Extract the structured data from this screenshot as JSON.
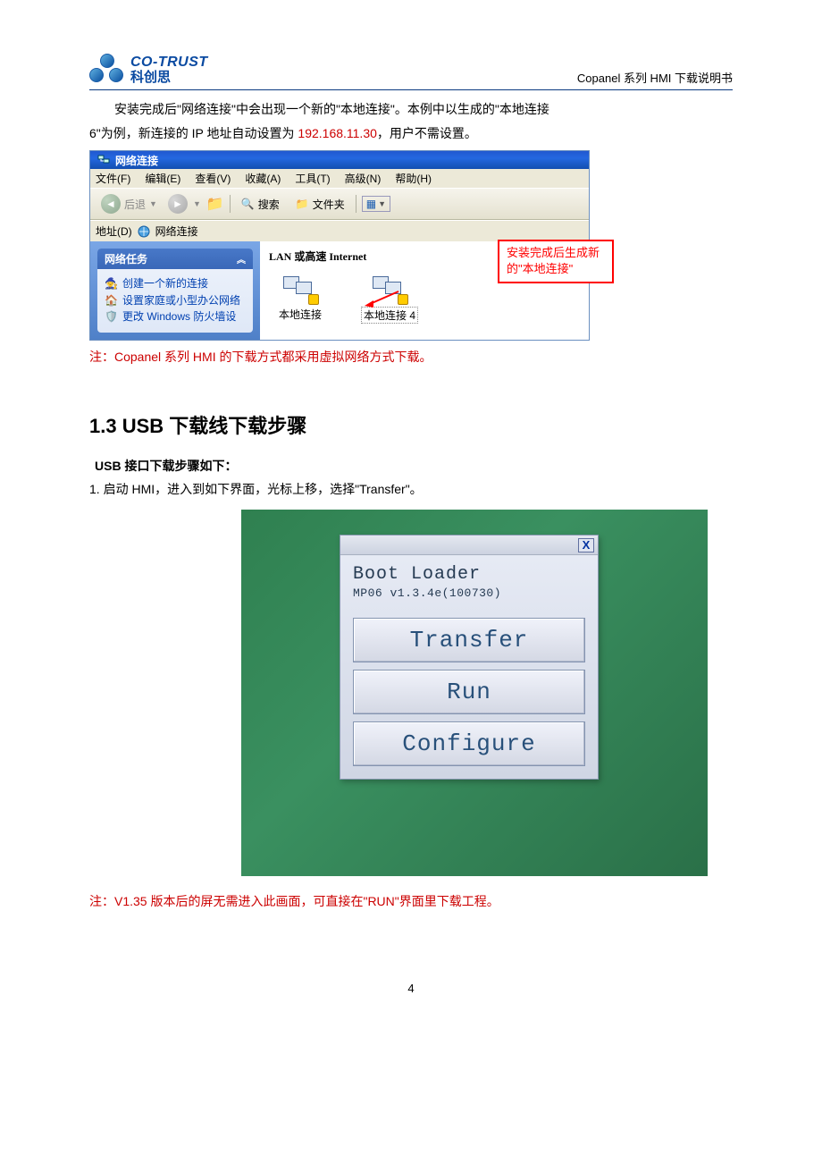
{
  "header": {
    "logo_en": "CO-TRUST",
    "logo_cn": "科创思",
    "doc_title": "Copanel 系列 HMI 下载说明书"
  },
  "intro": {
    "line1_a": "安装完成后\"网络连接\"中会出现一个新的\"本地连接\"。本例中以生成的\"本地连接",
    "line2_a": "6\"为例，新连接的 IP 地址自动设置为 ",
    "ip": "192.168.11.30",
    "line2_b": "，用户不需设置。"
  },
  "xp": {
    "title": "网络连接",
    "menu": {
      "file": "文件(F)",
      "edit": "编辑(E)",
      "view": "查看(V)",
      "fav": "收藏(A)",
      "tools": "工具(T)",
      "adv": "高级(N)",
      "help": "帮助(H)"
    },
    "toolbar": {
      "back": "后退",
      "search": "搜索",
      "folders": "文件夹"
    },
    "addr_label": "地址(D)",
    "addr_value": "网络连接",
    "side_title": "网络任务",
    "tasks": {
      "t1": "创建一个新的连接",
      "t2": "设置家庭或小型办公网络",
      "t3": "更改 Windows 防火墙设"
    },
    "section": "LAN 或高速 Internet",
    "conn1": "本地连接",
    "conn2": "本地连接 ⁠4",
    "callout": "安装完成后生成新的\"本地连接\""
  },
  "note1": "注：Copanel 系列 HMI 的下载方式都采用虚拟网络方式下载。",
  "section13": {
    "title": "1.3 USB 下载线下载步骤",
    "bold": "USB 接口下载步骤如下：",
    "step1": "1. 启动 HMI，进入到如下界面，光标上移，选择\"Transfer\"。"
  },
  "hmi": {
    "heading": "Boot Loader",
    "sub": "MP06 v1.3.4e(100730)",
    "btn1": "Transfer",
    "btn2": "Run",
    "btn3": "Configure"
  },
  "note2": "注：V1.35 版本后的屏无需进入此画面，可直接在\"RUN\"界面里下载工程。",
  "page_num": "4"
}
